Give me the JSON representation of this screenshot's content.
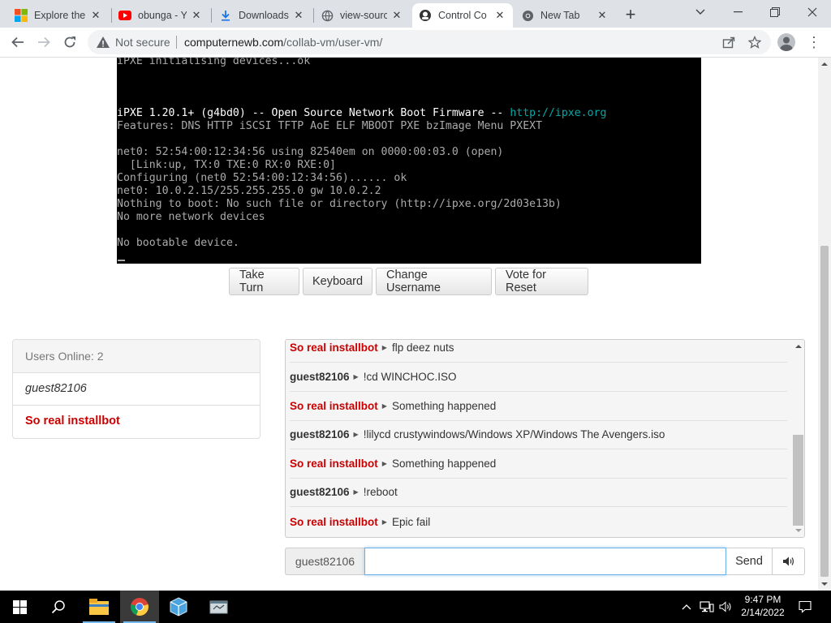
{
  "tabs": [
    {
      "title": "Explore the",
      "icon": "windows-logo-icon"
    },
    {
      "title": "obunga - Y",
      "icon": "youtube-icon"
    },
    {
      "title": "Downloads",
      "icon": "download-icon"
    },
    {
      "title": "view-sourc",
      "icon": "globe-icon"
    },
    {
      "title": "Control Co",
      "icon": "collabvm-icon",
      "active": true
    },
    {
      "title": "New Tab",
      "icon": "chrome-icon"
    }
  ],
  "toolbar": {
    "not_secure": "Not secure",
    "url_host": "computernewb.com",
    "url_path": "/collab-vm/user-vm/"
  },
  "vm_screen": {
    "lines": [
      {
        "text": "iPXE initialising devices...ok",
        "row": 0
      },
      {
        "text": "iPXE 1.20.1+ (g4bd0) -- Open Source Network Boot Firmware -- ",
        "link": "http://ipxe.org",
        "row": 4,
        "bright": true
      },
      {
        "text": "Features: DNS HTTP iSCSI TFTP AoE ELF MBOOT PXE bzImage Menu PXEXT",
        "row": 5
      },
      {
        "text": "net0: 52:54:00:12:34:56 using 82540em on 0000:00:03.0 (open)",
        "row": 7
      },
      {
        "text": "  [Link:up, TX:0 TXE:0 RX:0 RXE:0]",
        "row": 8
      },
      {
        "text": "Configuring (net0 52:54:00:12:34:56)...... ok",
        "row": 9
      },
      {
        "text": "net0: 10.0.2.15/255.255.255.0 gw 10.0.2.2",
        "row": 10
      },
      {
        "text": "Nothing to boot: No such file or directory (http://ipxe.org/2d03e13b)",
        "row": 11
      },
      {
        "text": "No more network devices",
        "row": 12
      },
      {
        "text": "No bootable device.",
        "row": 14
      }
    ]
  },
  "vm_buttons": {
    "take_turn": "Take Turn",
    "keyboard": "Keyboard",
    "change_username": "Change Username",
    "vote_reset": "Vote for Reset"
  },
  "users": {
    "header": "Users Online: 2",
    "list": [
      "guest82106",
      "So real installbot"
    ]
  },
  "chat": {
    "messages": [
      {
        "user": "So real installbot",
        "bot": true,
        "text": "flp deez nuts"
      },
      {
        "user": "guest82106",
        "bot": false,
        "text": "!cd WINCHOC.ISO"
      },
      {
        "user": "So real installbot",
        "bot": true,
        "text": "Something happened"
      },
      {
        "user": "guest82106",
        "bot": false,
        "text": "!lilycd crustywindows/Windows XP/Windows The Avengers.iso"
      },
      {
        "user": "So real installbot",
        "bot": true,
        "text": "Something happened"
      },
      {
        "user": "guest82106",
        "bot": false,
        "text": "!reboot"
      },
      {
        "user": "So real installbot",
        "bot": true,
        "text": "Epic fail"
      }
    ],
    "username": "guest82106",
    "input_value": "",
    "send": "Send"
  },
  "taskbar": {
    "time": "9:47 PM",
    "date": "2/14/2022"
  },
  "colors": {
    "bot_name": "#cc0000",
    "accent_blue": "#66afe9",
    "vm_link": "#00aaaa"
  }
}
